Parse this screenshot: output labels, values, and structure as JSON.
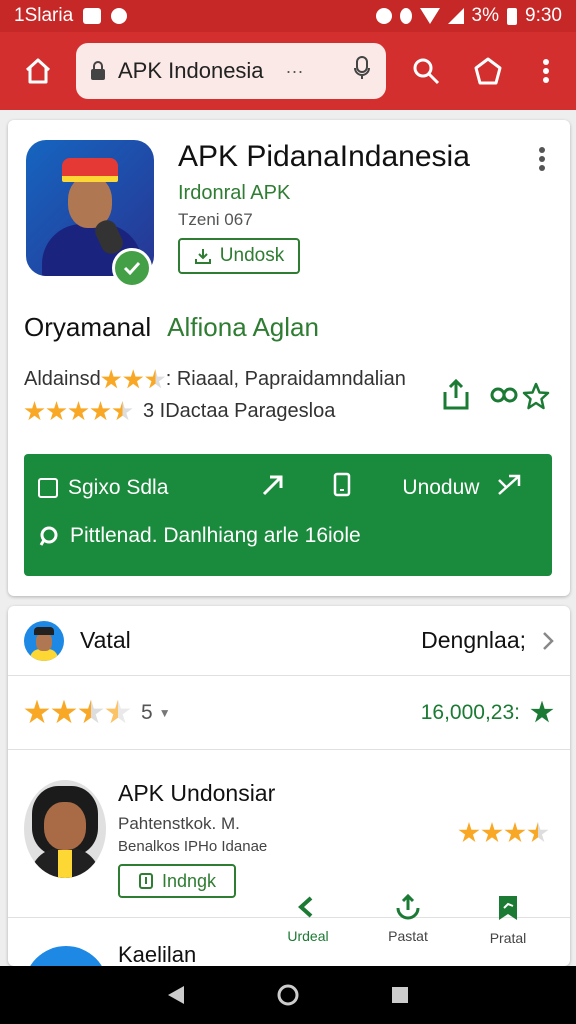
{
  "status_bar": {
    "left_text": "1Slaria",
    "right_text": "9:30",
    "battery_text": "3%"
  },
  "browser": {
    "url_text": "APK Indonesia",
    "url_dots": "···"
  },
  "app": {
    "title": "APK PidanaIndanesia",
    "subtitle": "Irdonral APK",
    "meta": "Tzeni 067",
    "install_label": "Undosk",
    "org_label": "Oryamanal",
    "org_value": "Alfiona Aglan",
    "desc_prefix": "Aldainsd",
    "desc_suffix": ": Riaaal, Papraidamndalian",
    "rating_text": "3 IDactaa Paragesloa",
    "panel_row1_left": "Sgixo Sdla",
    "panel_row1_right": "Unoduw",
    "panel_row2": "Pittlenad. Danlhiang arle 16iole"
  },
  "review_card": {
    "title": "Vatal",
    "right_label": "Dengnlaa;",
    "rating_count": "5",
    "total": "16,000,23:",
    "listing_title": "APK Undonsiar",
    "listing_line1": "Pahtenstkok. M.",
    "listing_line2": "Benalkos IPHo Idanae",
    "listing_button": "Indngk",
    "actions": [
      {
        "label": "Urdeal"
      },
      {
        "label": "Pastat"
      },
      {
        "label": "Pratal"
      }
    ],
    "next_title": "Kaelilan"
  },
  "colors": {
    "toolbar": "#d32f2f",
    "accent_green": "#1a8a3c",
    "star": "#f9a825"
  }
}
